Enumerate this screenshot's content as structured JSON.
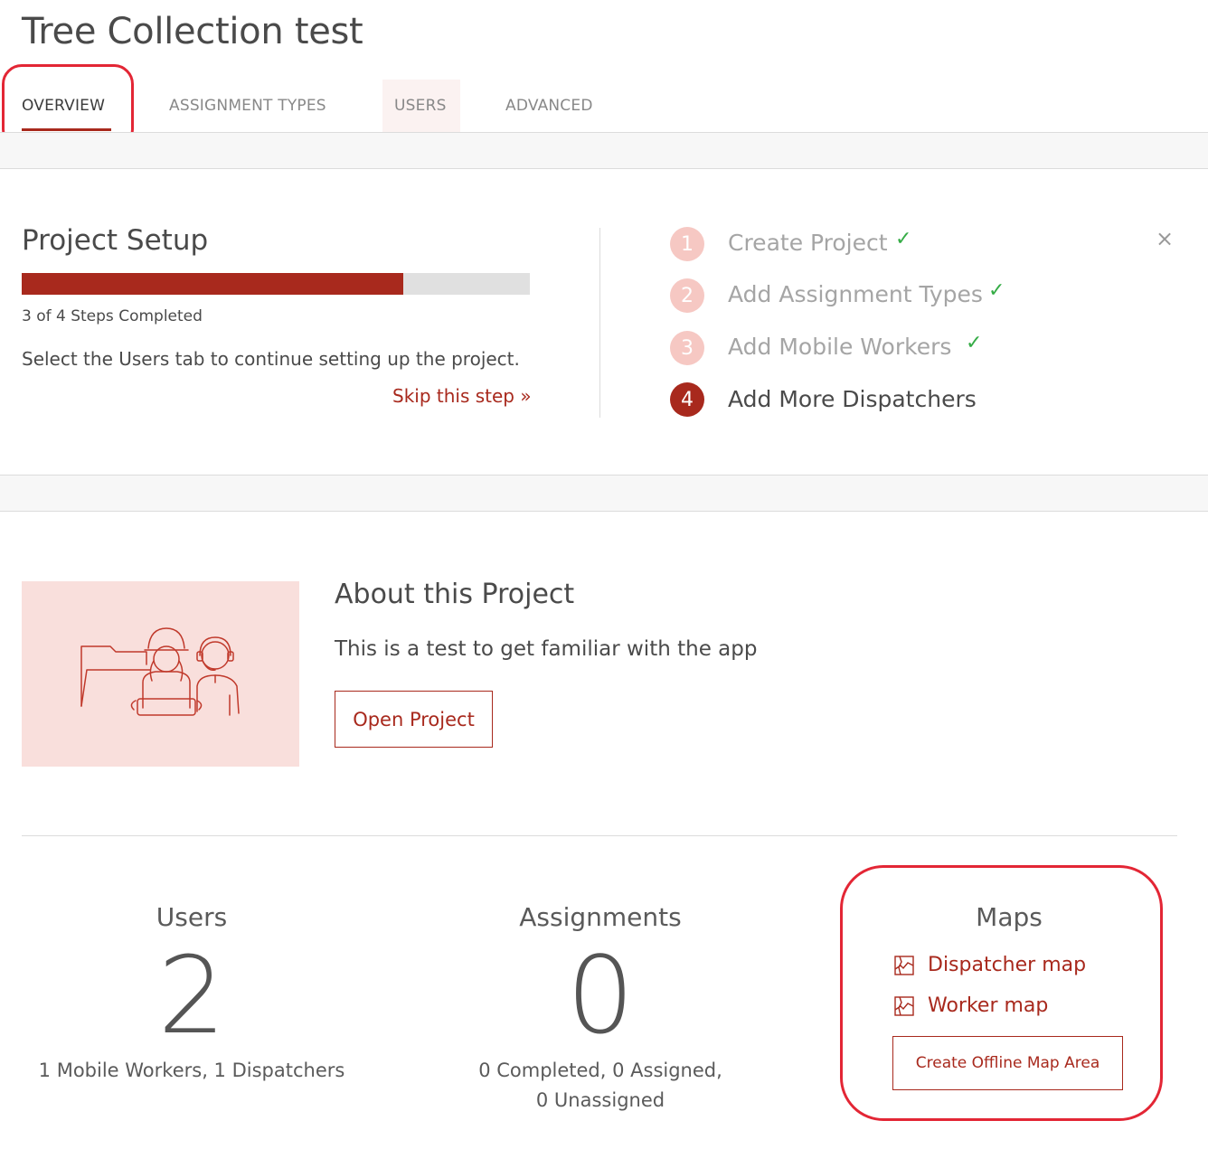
{
  "page": {
    "title": "Tree Collection test"
  },
  "tabs": [
    {
      "label": "OVERVIEW",
      "active": true
    },
    {
      "label": "ASSIGNMENT TYPES",
      "active": false
    },
    {
      "label": "USERS",
      "active": false
    },
    {
      "label": "ADVANCED",
      "active": false
    }
  ],
  "setup": {
    "title": "Project Setup",
    "progress_fraction": 0.75,
    "progress_text": "3 of 4 Steps Completed",
    "instruction": "Select the Users tab to continue setting up the project.",
    "skip_link": "Skip this step »",
    "close_icon": "×",
    "steps": [
      {
        "number": "1",
        "label": "Create Project",
        "done": true
      },
      {
        "number": "2",
        "label": "Add Assignment Types",
        "done": true
      },
      {
        "number": "3",
        "label": "Add Mobile Workers",
        "done": true
      },
      {
        "number": "4",
        "label": "Add More Dispatchers",
        "done": false
      }
    ],
    "check_glyph": "✓"
  },
  "about": {
    "title": "About this Project",
    "description": "This is a test to get familiar with the app",
    "open_button": "Open Project"
  },
  "stats": {
    "users": {
      "label": "Users",
      "value": "2",
      "sub": "1 Mobile Workers, 1 Dispatchers"
    },
    "assignments": {
      "label": "Assignments",
      "value": "0",
      "sub_line1": "0 Completed, 0 Assigned,",
      "sub_line2": "0 Unassigned"
    },
    "maps": {
      "label": "Maps",
      "dispatcher_link": "Dispatcher map",
      "worker_link": "Worker map",
      "offline_button": "Create Offline Map Area"
    }
  },
  "colors": {
    "accent": "#a8291d",
    "accent_light": "#f6c8c3",
    "check": "#35ac46",
    "highlight_ring": "#e32635"
  }
}
